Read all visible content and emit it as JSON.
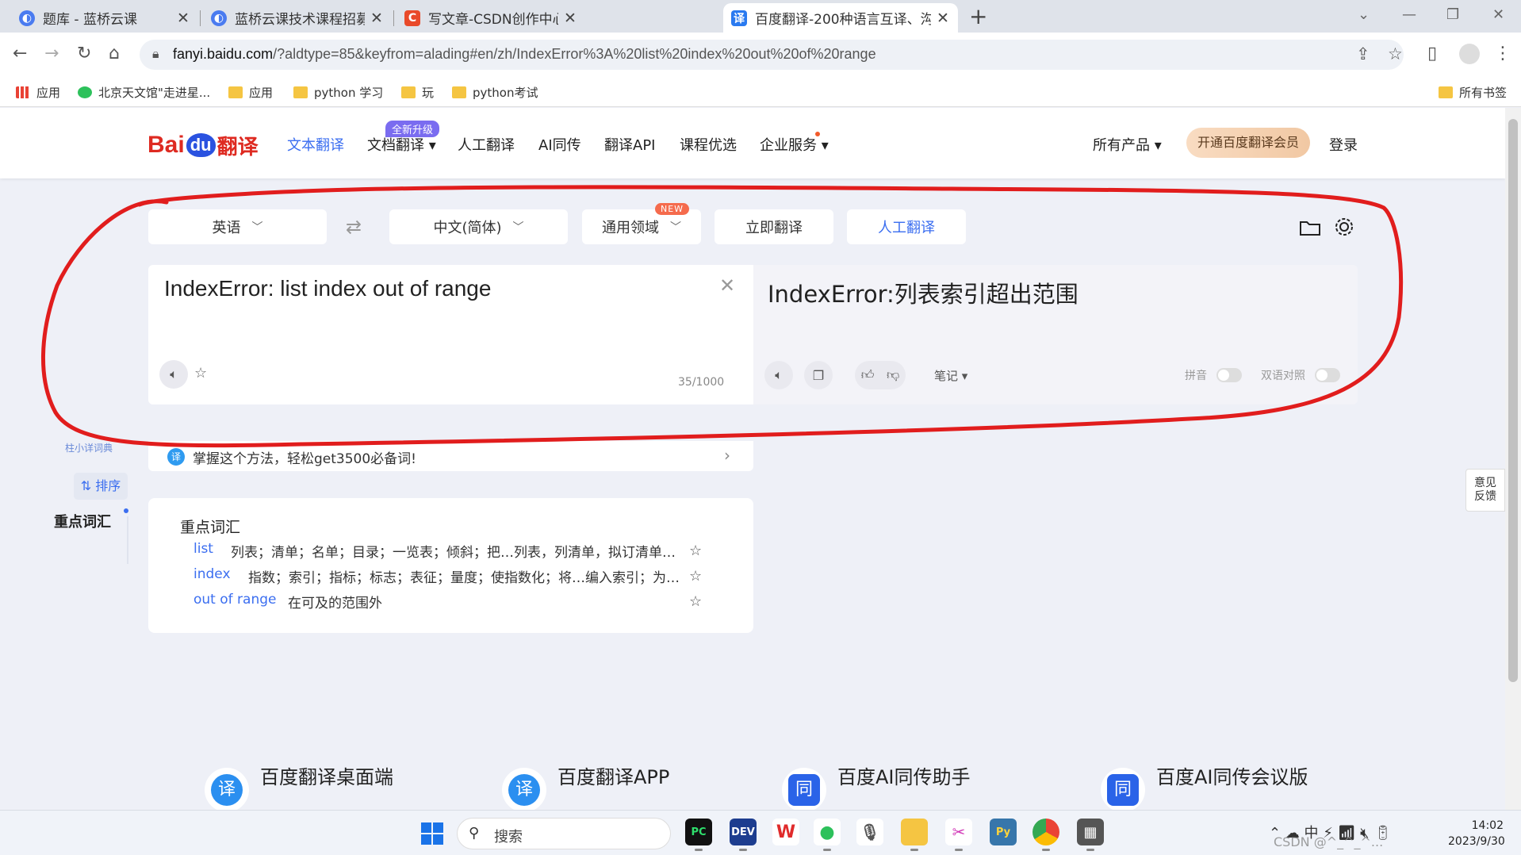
{
  "browser": {
    "tabs": [
      {
        "title": "题库 - 蓝桥云课",
        "close": "✕"
      },
      {
        "title": "蓝桥云课技术课程招募 - 蓝桥云",
        "close": "✕"
      },
      {
        "title": "写文章-CSDN创作中心",
        "close": "✕"
      },
      {
        "title": "百度翻译-200种语言互译、沟通",
        "close": "✕"
      }
    ],
    "new_tab": "+",
    "url_host": "fanyi.baidu.com",
    "url_rest": "/?aldtype=85&keyfrom=alading#en/zh/IndexError%3A%20list%20index%20out%20of%20range",
    "bookmarks": [
      "应用",
      "北京天文馆\"走进星...",
      "应用",
      "python 学习",
      "玩",
      "python考试"
    ],
    "all_bookmarks": "所有书签"
  },
  "header": {
    "logo": {
      "bai": "Bai",
      "du": "du",
      "fy": "翻译"
    },
    "nav": [
      "文本翻译",
      "文档翻译",
      "人工翻译",
      "AI同传",
      "翻译API",
      "课程优选",
      "企业服务"
    ],
    "upgrade_badge": "全新升级",
    "all_products": "所有产品",
    "vip_button": "开通百度翻译会员",
    "login": "登录"
  },
  "controls": {
    "source_lang": "英语",
    "target_lang": "中文(简体)",
    "domain": "通用领域",
    "new_badge": "NEW",
    "translate_now": "立即翻译",
    "human_translate": "人工翻译"
  },
  "source": {
    "text": "IndexError: list index out of range",
    "count": "35/1000"
  },
  "target": {
    "text": "IndexError:列表索引超出范围",
    "note": "笔记",
    "pinyin": "拼音",
    "bilingual": "双语对照"
  },
  "tip": {
    "text": "掌握这个方法，轻松get3500必备词!",
    "icon": "译"
  },
  "sidebar": {
    "dict_link": "柱小详词典",
    "sort": "排序",
    "vocab": "重点词汇"
  },
  "vocab": {
    "title": "重点词汇",
    "rows": [
      {
        "word": "list",
        "def": "列表；清单；名单；目录；一览表；倾斜；把…列表，列清单，拟订清单；…"
      },
      {
        "word": "index",
        "def": "指数；索引；指标；标志；表征；量度；使指数化；将…编入索引；为……"
      },
      {
        "word": "out of range",
        "def": "在可及的范围外"
      }
    ]
  },
  "feedback": {
    "line1": "意见",
    "line2": "反馈"
  },
  "apps": [
    {
      "label": "百度翻译桌面端",
      "icon": "译"
    },
    {
      "label": "百度翻译APP",
      "icon": "译"
    },
    {
      "label": "百度AI同传助手",
      "icon": "同"
    },
    {
      "label": "百度AI同传会议版",
      "icon": "同"
    }
  ],
  "taskbar": {
    "search": "搜索",
    "tray": "中",
    "time": "14:02",
    "date": "2023/9/30",
    "watermark": "CSDN @^_^_^..."
  },
  "colors": {
    "accent": "#3b6ef0",
    "baidu_red": "#de2a21",
    "annotation": "#e11d1d"
  }
}
